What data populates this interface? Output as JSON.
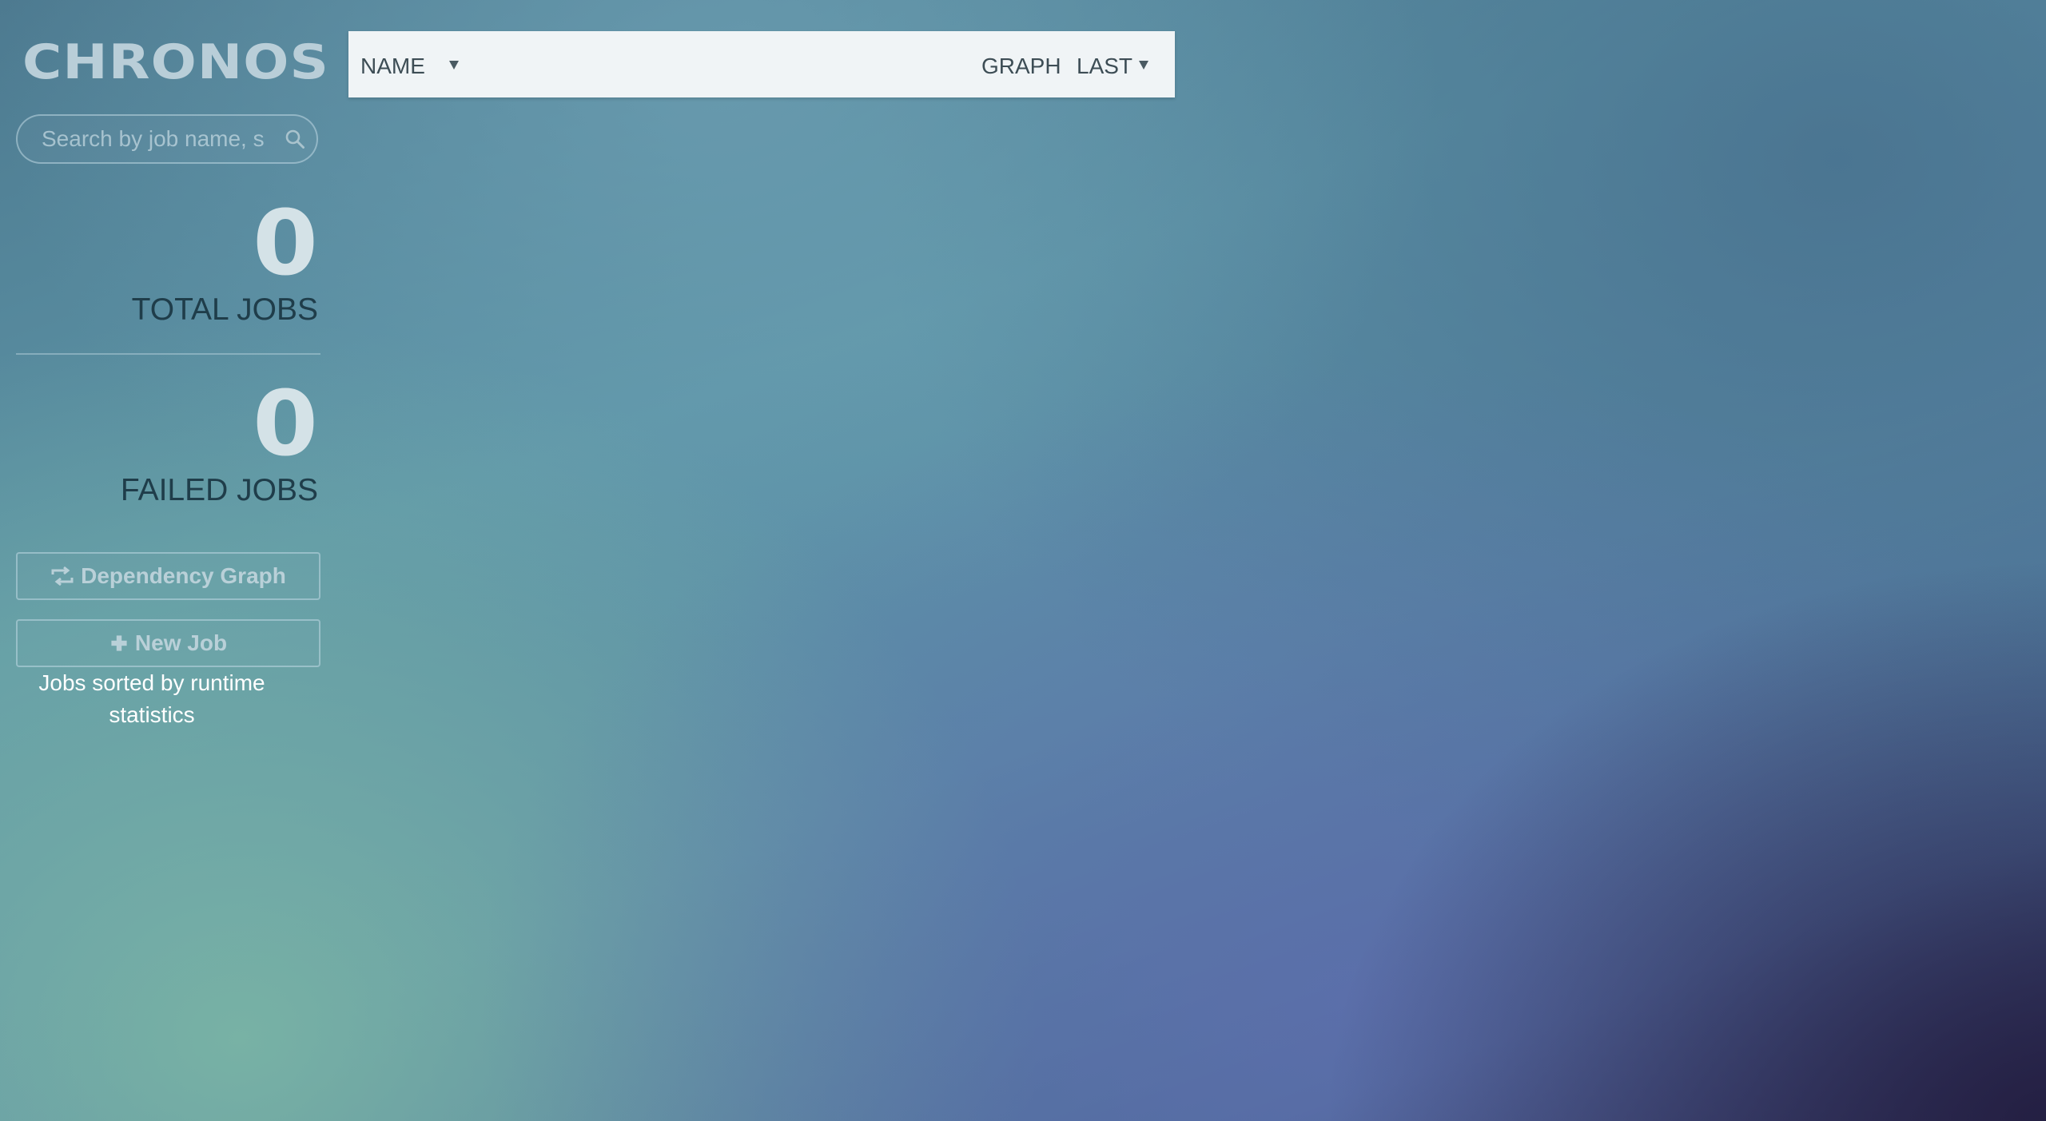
{
  "app": {
    "logo": "CHRONOS"
  },
  "search": {
    "placeholder": "Search by job name, s",
    "value": "",
    "icon": "search-icon"
  },
  "stats": {
    "total_jobs": {
      "value": "0",
      "label": "TOTAL JOBS"
    },
    "failed_jobs": {
      "value": "0",
      "label": "FAILED JOBS"
    }
  },
  "actions": {
    "dependency_graph": {
      "label": "Dependency Graph",
      "icon": "retweet-icon"
    },
    "new_job": {
      "label": "New Job",
      "icon": "plus-icon"
    }
  },
  "hint": "Jobs sorted by runtime statistics",
  "table": {
    "columns": {
      "name": "NAME",
      "graph": "GRAPH",
      "last": "LAST"
    }
  },
  "colors": {
    "logo": "#b9ced8",
    "stat_number": "#d4e2e7",
    "stat_label": "#1f3d4a",
    "header_bg": "#f0f4f6"
  }
}
